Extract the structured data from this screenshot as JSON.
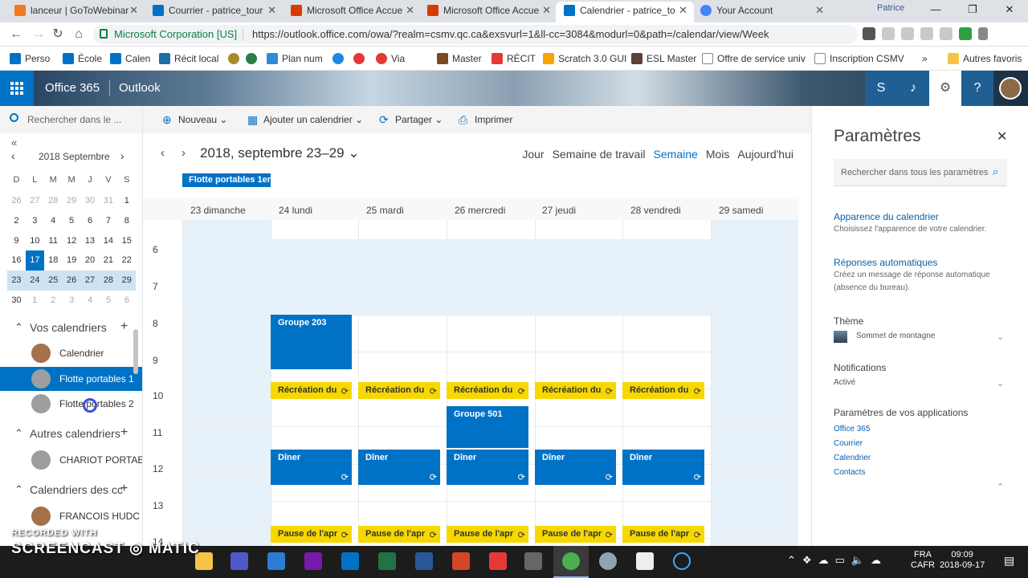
{
  "browser": {
    "tabs": [
      {
        "label": "lanceur | GoToWebinar",
        "color": "#f47a20"
      },
      {
        "label": "Courrier - patrice_tour",
        "color": "#0072c6"
      },
      {
        "label": "Microsoft Office Accue",
        "color": "#d83b01"
      },
      {
        "label": "Microsoft Office Accue",
        "color": "#d83b01"
      },
      {
        "label": "Calendrier - patrice_to",
        "color": "#0072c6"
      },
      {
        "label": "Your Account",
        "color": "#4285f4"
      }
    ],
    "profile": "Patrice",
    "org": "Microsoft Corporation [US]",
    "url": "https://outlook.office.com/owa/?realm=csmv.qc.ca&exsvurl=1&ll-cc=3084&modurl=0&path=/calendar/view/Week",
    "bookmarks": [
      "Perso",
      "École",
      "Calen",
      "Récit local",
      "Plan num",
      "Via",
      "Master",
      "RÉCIT",
      "Scratch 3.0 GUI",
      "ESL Master",
      "Offre de service univ",
      "Inscription CSMV",
      "Autres favoris"
    ]
  },
  "header": {
    "brand": "Office 365",
    "app": "Outlook"
  },
  "leftnav": {
    "search_placeholder": "Rechercher dans le ...",
    "mini_cal_title": "2018 Septembre",
    "dow": [
      "D",
      "L",
      "M",
      "M",
      "J",
      "V",
      "S"
    ],
    "weeks": [
      [
        "26",
        "27",
        "28",
        "29",
        "30",
        "31",
        "1"
      ],
      [
        "2",
        "3",
        "4",
        "5",
        "6",
        "7",
        "8"
      ],
      [
        "9",
        "10",
        "11",
        "12",
        "13",
        "14",
        "15"
      ],
      [
        "16",
        "17",
        "18",
        "19",
        "20",
        "21",
        "22"
      ],
      [
        "23",
        "24",
        "25",
        "26",
        "27",
        "28",
        "29"
      ],
      [
        "30",
        "1",
        "2",
        "3",
        "4",
        "5",
        "6"
      ]
    ],
    "my_calendars_label": "Vos calendriers",
    "my_calendars": [
      "Calendrier",
      "Flotte portables 1",
      "Flotte portables 2"
    ],
    "other_calendars_label": "Autres calendriers",
    "other_calendars": [
      "CHARIOT PORTAE"
    ],
    "shared_label": "Calendriers des cc",
    "shared": [
      "FRANCOIS HUDC"
    ]
  },
  "toolbar": {
    "new": "Nouveau",
    "add_calendar": "Ajouter un calendrier",
    "share": "Partager",
    "print": "Imprimer"
  },
  "calendar": {
    "range": "2018, septembre 23–29",
    "views": [
      "Jour",
      "Semaine de travail",
      "Semaine",
      "Mois",
      "Aujourd'hui"
    ],
    "allday": "Flotte portables 1er c",
    "days": [
      "23 dimanche",
      "24 lundi",
      "25 mardi",
      "26 mercredi",
      "27 jeudi",
      "28 vendredi",
      "29 samedi"
    ],
    "hours": [
      "6",
      "7",
      "8",
      "9",
      "10",
      "11",
      "12",
      "13",
      "14"
    ],
    "events": {
      "groupe203": "Groupe 203",
      "recreation": "Récréation du",
      "groupe501": "Groupe 501",
      "diner": "Dîner",
      "pause": "Pause de l'apr"
    }
  },
  "settings": {
    "title": "Paramètres",
    "search_placeholder": "Rechercher dans tous les paramètres",
    "appearance_link": "Apparence du calendrier",
    "appearance_desc": "Choisissez l'apparence de votre calendrier.",
    "auto_link": "Réponses automatiques",
    "auto_desc": "Créez un message de réponse automatique (absence du bureau).",
    "theme_label": "Thème",
    "theme_value": "Sommet de montagne",
    "notif_label": "Notifications",
    "notif_value": "Activé",
    "apps_label": "Paramètres de vos applications",
    "apps": [
      "Office 365",
      "Courrier",
      "Calendrier",
      "Contacts"
    ]
  },
  "taskbar": {
    "watermark_top": "RECORDED WITH",
    "watermark_brand": "SCREENCAST ◎ MATIC",
    "lang1": "FRA",
    "lang2": "CAFR",
    "time": "09:09",
    "date": "2018-09-17"
  }
}
